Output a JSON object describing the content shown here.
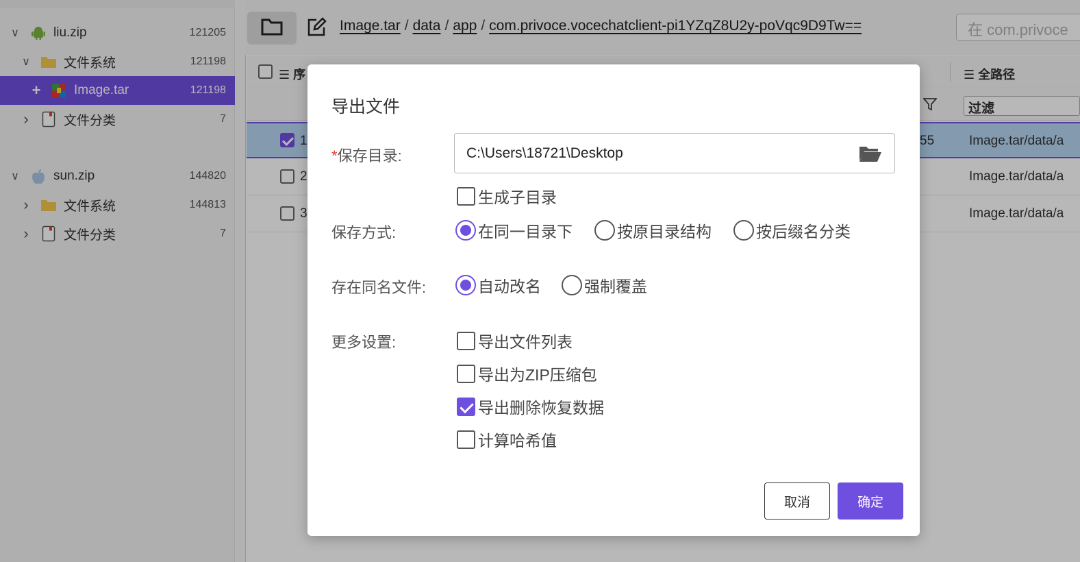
{
  "tree": [
    {
      "label": "liu.zip",
      "count": "121205",
      "icon": "android-icon",
      "toggle": "∨"
    },
    {
      "label": "文件系统",
      "count": "121198",
      "icon": "folder-icon",
      "toggle": "∨"
    },
    {
      "label": "Image.tar",
      "count": "121198",
      "icon": "archive-icon",
      "toggle": "+"
    },
    {
      "label": "文件分类",
      "count": "7",
      "icon": "category-icon",
      "toggle": "›"
    },
    {
      "label": "sun.zip",
      "count": "144820",
      "icon": "apple-icon",
      "toggle": "∨"
    },
    {
      "label": "文件系统",
      "count": "144813",
      "icon": "folder-icon",
      "toggle": "›"
    },
    {
      "label": "文件分类",
      "count": "7",
      "icon": "category-icon",
      "toggle": "›"
    }
  ],
  "breadcrumb": {
    "items": [
      "Image.tar",
      "data",
      "app",
      "com.privoce.vocechatclient-pi1YZqZ8U2y-poVqc9D9Tw=="
    ],
    "sep": "/"
  },
  "search": {
    "placeholder": "在 com.privoce"
  },
  "table": {
    "col_index": "序",
    "col_path": "全路径",
    "filter": "过滤",
    "rows": [
      {
        "num": "1",
        "extra": "55",
        "path": "Image.tar/data/a"
      },
      {
        "num": "2",
        "extra": "",
        "path": "Image.tar/data/a"
      },
      {
        "num": "3",
        "extra": "",
        "path": "Image.tar/data/a"
      }
    ]
  },
  "dialog": {
    "title": "导出文件",
    "req_mark": "*",
    "save_dir_label": "保存目录:",
    "save_dir_value": "C:\\Users\\18721\\Desktop",
    "subdir_label": "生成子目录",
    "save_mode_label": "保存方式:",
    "save_modes": [
      "在同一目录下",
      "按原目录结构",
      "按后缀名分类"
    ],
    "dup_label": "存在同名文件:",
    "dup_modes": [
      "自动改名",
      "强制覆盖"
    ],
    "more_label": "更多设置:",
    "more_opts": [
      "导出文件列表",
      "导出为ZIP压缩包",
      "导出删除恢复数据",
      "计算哈希值"
    ],
    "cancel": "取消",
    "ok": "确定"
  },
  "colors": {
    "accent": "#6f4fe0",
    "selected_row": "#b8d6f3"
  }
}
